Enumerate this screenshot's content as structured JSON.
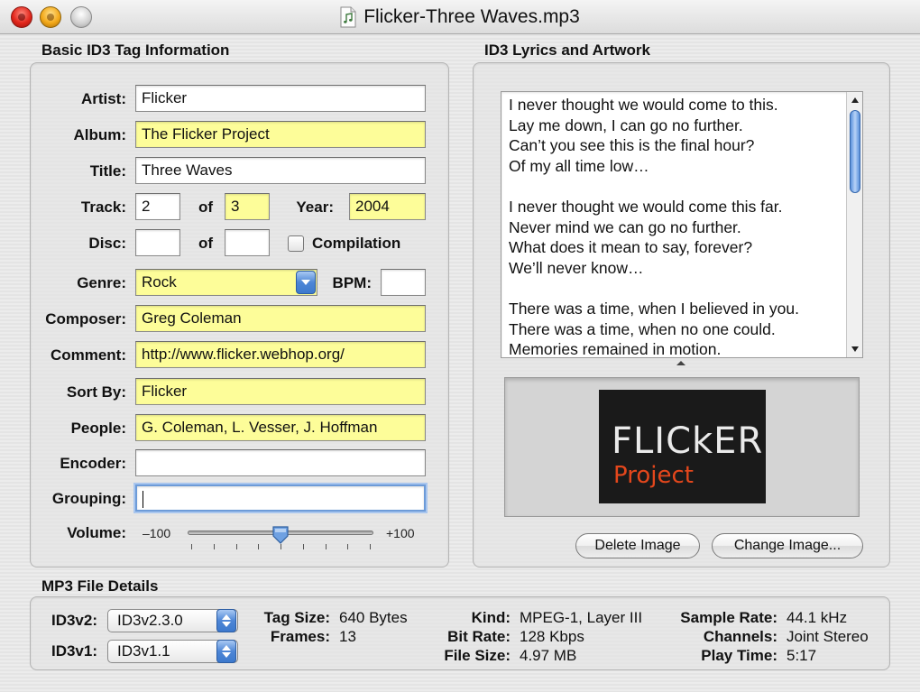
{
  "window": {
    "title": "Flicker-Three Waves.mp3"
  },
  "basic": {
    "heading": "Basic ID3 Tag Information",
    "artist": {
      "label": "Artist:",
      "value": "Flicker"
    },
    "album": {
      "label": "Album:",
      "value": "The Flicker Project"
    },
    "title": {
      "label": "Title:",
      "value": "Three Waves"
    },
    "track": {
      "label": "Track:",
      "value": "2",
      "of_label": "of",
      "of_value": "3"
    },
    "year": {
      "label": "Year:",
      "value": "2004"
    },
    "disc": {
      "label": "Disc:",
      "value": "",
      "of_label": "of",
      "of_value": ""
    },
    "compilation": {
      "label": "Compilation",
      "checked": false
    },
    "genre": {
      "label": "Genre:",
      "value": "Rock"
    },
    "bpm": {
      "label": "BPM:",
      "value": ""
    },
    "composer": {
      "label": "Composer:",
      "value": "Greg Coleman"
    },
    "comment": {
      "label": "Comment:",
      "value": "http://www.flicker.webhop.org/"
    },
    "sort_by": {
      "label": "Sort By:",
      "value": "Flicker"
    },
    "people": {
      "label": "People:",
      "value": "G. Coleman, L. Vesser, J. Hoffman"
    },
    "encoder": {
      "label": "Encoder:",
      "value": ""
    },
    "grouping": {
      "label": "Grouping:",
      "value": ""
    },
    "volume": {
      "label": "Volume:",
      "min_label": "–100",
      "max_label": "+100",
      "value": 0
    }
  },
  "lyrics": {
    "heading": "ID3 Lyrics and Artwork",
    "text": "I never thought we would come to this.\nLay me down, I can go no further.\nCan’t you see this is the final hour?\nOf my all time low…\n\nI never thought we would come this far.\nNever mind we can go no further.\nWhat does it mean to say, forever?\nWe’ll never know…\n\nThere was a time, when I believed in you.\nThere was a time, when no one could.\nMemories remained in motion.",
    "artwork_line1": "FLICkER",
    "artwork_line2": "Project",
    "delete_label": "Delete Image",
    "change_label": "Change Image..."
  },
  "details": {
    "heading": "MP3 File Details",
    "id3v2": {
      "label": "ID3v2:",
      "value": "ID3v2.3.0"
    },
    "id3v1": {
      "label": "ID3v1:",
      "value": "ID3v1.1"
    },
    "tag_size": {
      "label": "Tag Size:",
      "value": "640 Bytes"
    },
    "frames": {
      "label": "Frames:",
      "value": "13"
    },
    "kind": {
      "label": "Kind:",
      "value": "MPEG-1, Layer III"
    },
    "bit_rate": {
      "label": "Bit Rate:",
      "value": "128 Kbps"
    },
    "file_size": {
      "label": "File Size:",
      "value": "4.97 MB"
    },
    "sample_rate": {
      "label": "Sample Rate:",
      "value": "44.1 kHz"
    },
    "channels": {
      "label": "Channels:",
      "value": "Joint Stereo"
    },
    "play_time": {
      "label": "Play Time:",
      "value": "5:17"
    }
  },
  "colors": {
    "highlight_field": "#fdfd99",
    "focus_ring": "#6d9bd8",
    "accent": "#4d86d6"
  },
  "icons": [
    "close-icon",
    "minimize-icon",
    "zoom-icon",
    "music-file-icon",
    "chevron-down-icon",
    "up-down-arrows-icon"
  ]
}
